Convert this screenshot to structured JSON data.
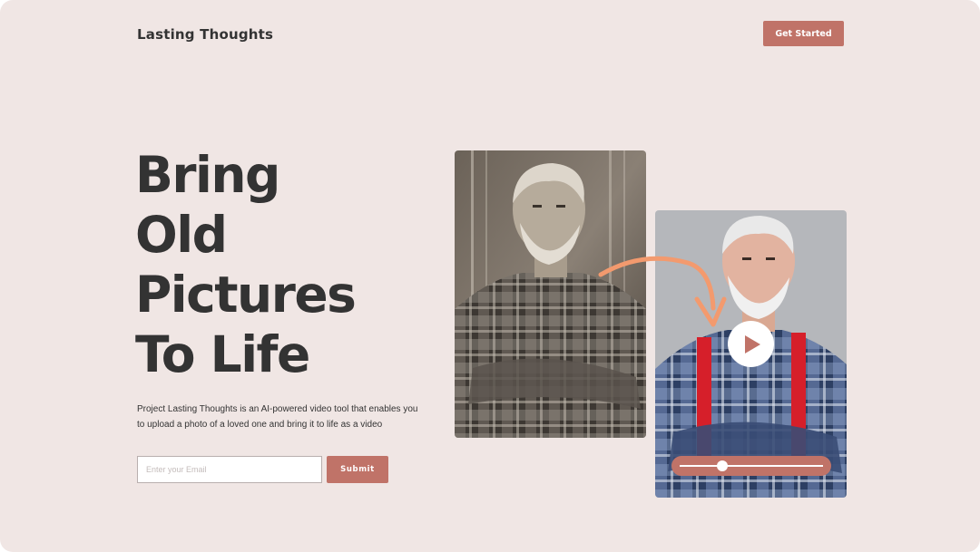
{
  "header": {
    "brand": "Lasting Thoughts",
    "cta_label": "Get Started"
  },
  "hero": {
    "headline_lines": [
      "Bring",
      "Old",
      "Pictures",
      "To Life"
    ],
    "description": "Project Lasting Thoughts is an AI-powered video tool that enables you to upload a photo of a loved one and bring it to life as a video"
  },
  "signup": {
    "email_placeholder": "Enter your Email",
    "email_value": "",
    "submit_label": "Submit"
  },
  "media": {
    "old_photo": {
      "style": "sepia",
      "subject": "elderly bearded man, arms crossed"
    },
    "new_photo": {
      "style": "color",
      "subject": "elderly bearded man, arms crossed"
    },
    "arrow_icon": "curved-arrow-icon",
    "play_icon": "play-icon",
    "video_progress": 0.3
  },
  "colors": {
    "background": "#f0e6e4",
    "accent": "#c07368",
    "text": "#333333",
    "arrow": "#f39a6e"
  }
}
